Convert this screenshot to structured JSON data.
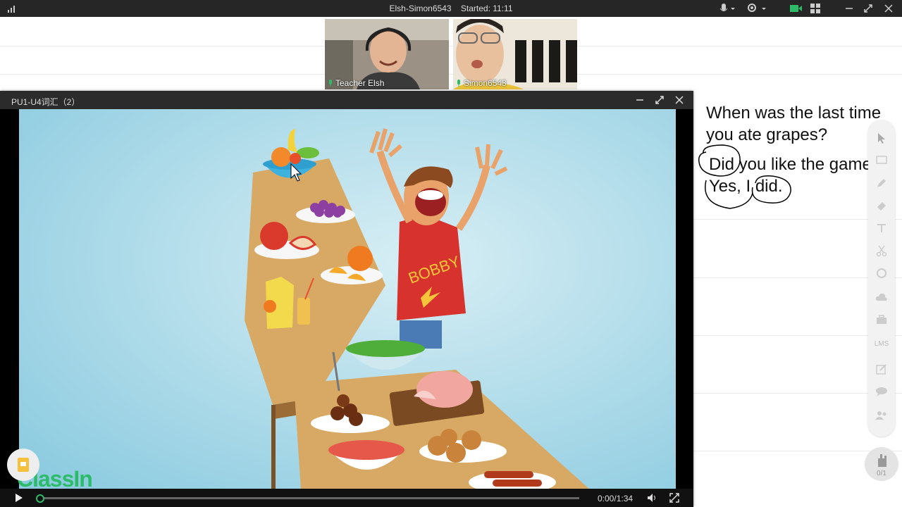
{
  "topbar": {
    "room": "Elsh-Simon6543",
    "started": "Started: 11:11"
  },
  "videos": [
    {
      "name": "Teacher Elsh"
    },
    {
      "name": "Simon6543"
    }
  ],
  "player": {
    "title": "PU1-U4词汇（2）",
    "time": "0:00/1:34",
    "progress_fraction": 0.0
  },
  "shirt_text": "BOBBY",
  "notes": {
    "line1": "When was the last time",
    "line2": "you ate grapes?",
    "line3": "Did you like the game?",
    "line4": "Yes, I did."
  },
  "tools": [
    "pointer-icon",
    "screen-icon",
    "pen-icon",
    "eraser-icon",
    "text-icon",
    "scissors-icon",
    "shape-icon",
    "cloud-icon",
    "toolbox-icon",
    "lms-icon",
    "edit-icon",
    "chat-icon",
    "users-icon"
  ],
  "tool_label_lms": "LMS",
  "user_count": "0/1",
  "logo": "ClassIn",
  "colors": {
    "accent": "#2dbb6a",
    "sky": "#a8d8e6"
  }
}
